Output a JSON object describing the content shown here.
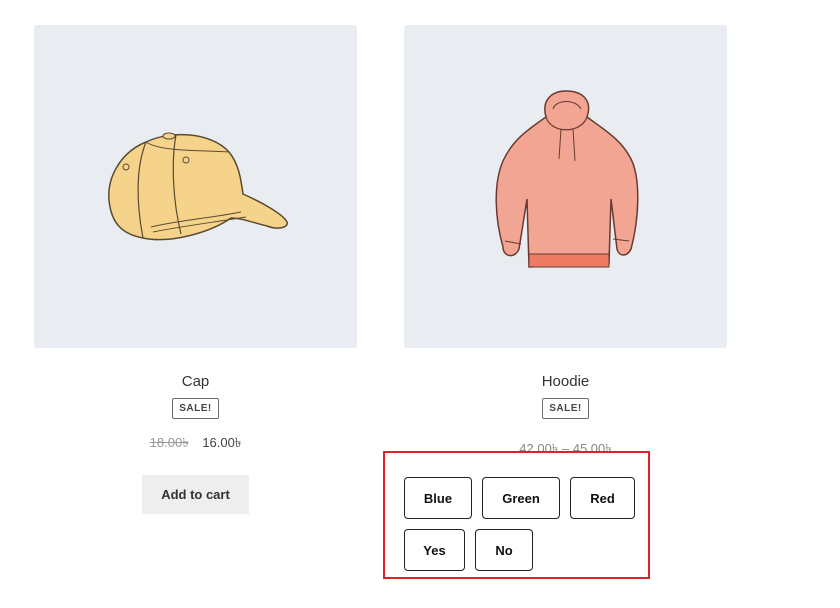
{
  "products": [
    {
      "title": "Cap",
      "badge": "SALE!",
      "price_old": "18.00৳",
      "price_new": "16.00৳",
      "cart_label": "Add to cart",
      "image_icon": "cap-image"
    },
    {
      "title": "Hoodie",
      "badge": "SALE!",
      "price_range": "42.00৳ – 45.00৳",
      "image_icon": "hoodie-image"
    }
  ],
  "variations": {
    "colors": [
      "Blue",
      "Green",
      "Red"
    ],
    "logo": [
      "Yes",
      "No"
    ]
  },
  "colors": {
    "highlight": "#e0202a",
    "thumb_bg": "#e9edf2",
    "cap_fill": "#f6d38a",
    "hoodie_fill": "#f3a593"
  }
}
